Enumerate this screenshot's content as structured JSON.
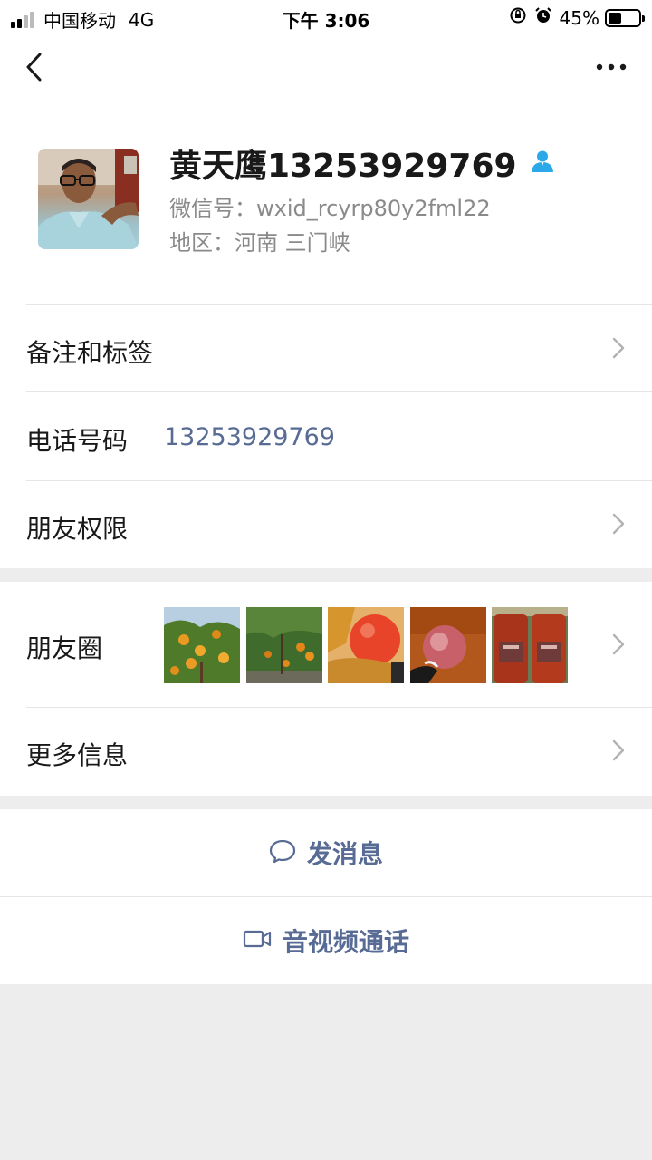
{
  "status_bar": {
    "carrier": "中国移动",
    "network": "4G",
    "time": "下午 3:06",
    "battery_percent": "45%",
    "battery_level": 0.45,
    "signal_bars_filled": 2,
    "signal_bars_total": 4
  },
  "nav": {
    "back_icon": "chevron-left-icon",
    "more_icon": "more-dots-icon"
  },
  "profile": {
    "name": "黄天鹰13253929769",
    "wechat_id": "微信号：wxid_rcyrp80y2fml22",
    "region": "地区：河南 三门峡",
    "contact_icon_color": "#2aa8e8"
  },
  "rows": {
    "remarks_tags": "备注和标签",
    "phone_label": "电话号码",
    "phone_value": "13253929769",
    "friend_permissions": "朋友权限",
    "moments": "朋友圈",
    "more_info": "更多信息"
  },
  "actions": {
    "send_message": "发消息",
    "video_call": "音视频通话"
  },
  "colors": {
    "link_blue": "#576b95",
    "background_gray": "#ededed",
    "divider": "#e5e5e5"
  }
}
